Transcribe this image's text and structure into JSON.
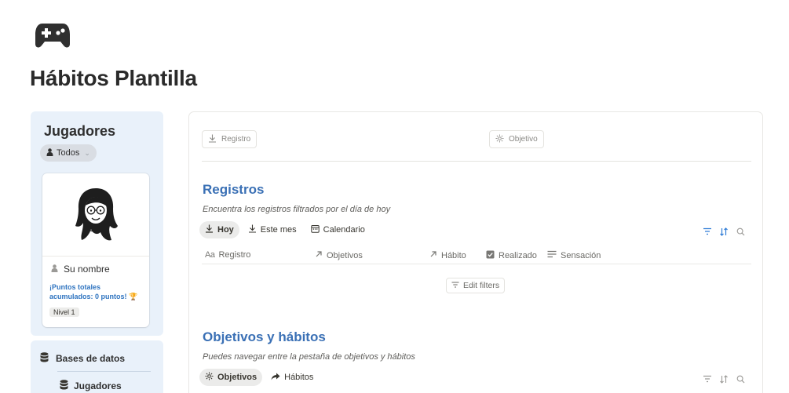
{
  "page": {
    "icon": "gamepad-icon",
    "title": "Hábitos Plantilla"
  },
  "players": {
    "title": "Jugadores",
    "filter_label": "Todos",
    "card": {
      "name": "Su nombre",
      "points_text": "¡Puntos totales acumulados: 0 puntos! 🏆",
      "level": "Nivel 1"
    }
  },
  "databases": {
    "title": "Bases de datos",
    "items": [
      "Jugadores"
    ]
  },
  "main": {
    "top_buttons": {
      "registro": "Registro",
      "objetivo": "Objetivo"
    },
    "registros": {
      "title": "Registros",
      "description": "Encuentra los registros filtrados por el día de hoy",
      "tabs": [
        "Hoy",
        "Este mes",
        "Calendario"
      ],
      "columns": [
        "Registro",
        "Objetivos",
        "Hábito",
        "Realizado",
        "Sensación"
      ],
      "empty_action": "Edit filters"
    },
    "objetivos": {
      "title": "Objetivos y hábitos",
      "description": "Puedes navegar entre la pestaña de objetivos y hábitos",
      "tabs": [
        "Objetivos",
        "Hábitos"
      ]
    }
  },
  "colors": {
    "accent_blue": "#3a70b5",
    "panel_bg": "#e9f1fa"
  }
}
